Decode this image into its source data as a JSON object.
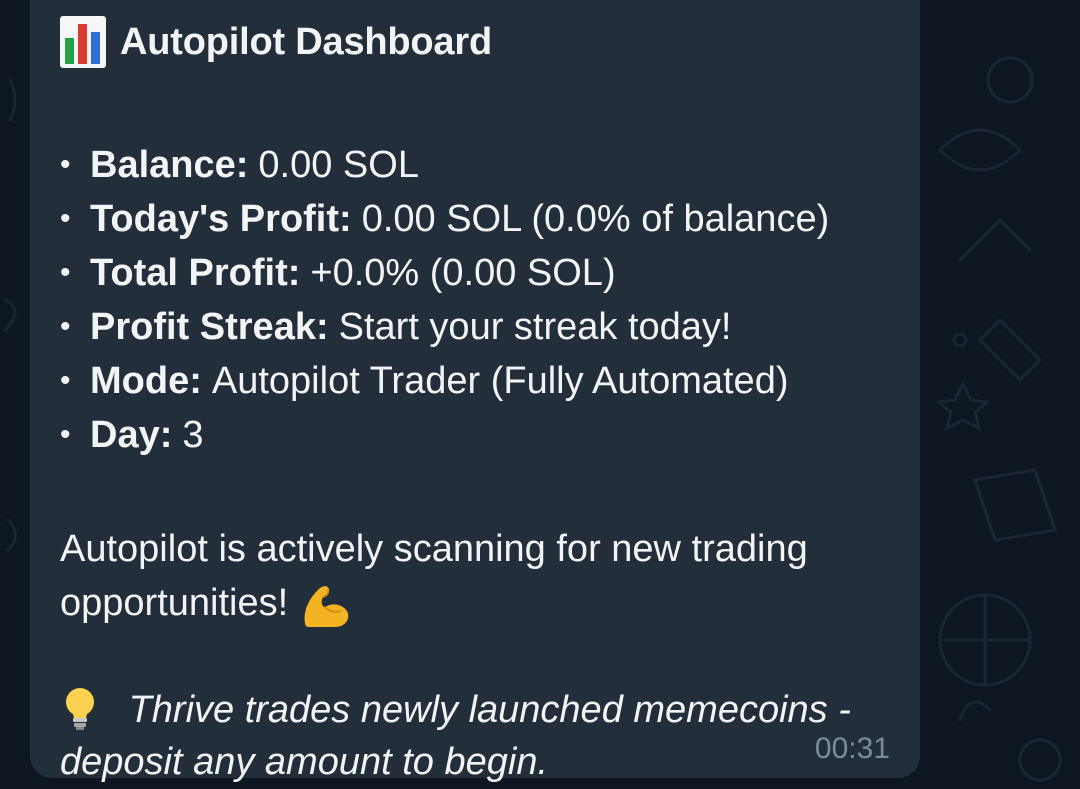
{
  "message": {
    "title": "Autopilot Dashboard",
    "stats": [
      {
        "label": "Balance:",
        "value": "0.00 SOL"
      },
      {
        "label": "Today's Profit:",
        "value": "0.00 SOL (0.0% of balance)"
      },
      {
        "label": "Total Profit:",
        "value": "+0.0% (0.00 SOL)"
      },
      {
        "label": "Profit Streak:",
        "value": "Start your streak today!"
      },
      {
        "label": "Mode:",
        "value": "Autopilot Trader (Fully Automated)"
      },
      {
        "label": "Day:",
        "value": "3"
      }
    ],
    "bullet": "•",
    "status_line1": "Autopilot is actively scanning for new trading",
    "status_line2": "opportunities!",
    "hint_line1": "Thrive trades newly launched memecoins -",
    "hint_line2": "deposit any amount to begin.",
    "time": "00:31"
  },
  "icons": {
    "title_icon": "bar-chart-icon",
    "status_icon": "flexed-biceps-icon",
    "hint_icon": "light-bulb-icon"
  },
  "colors": {
    "background": "#0e1621",
    "bubble": "#222e3a",
    "text": "#f2f4f6",
    "time": "#7c8b99"
  }
}
